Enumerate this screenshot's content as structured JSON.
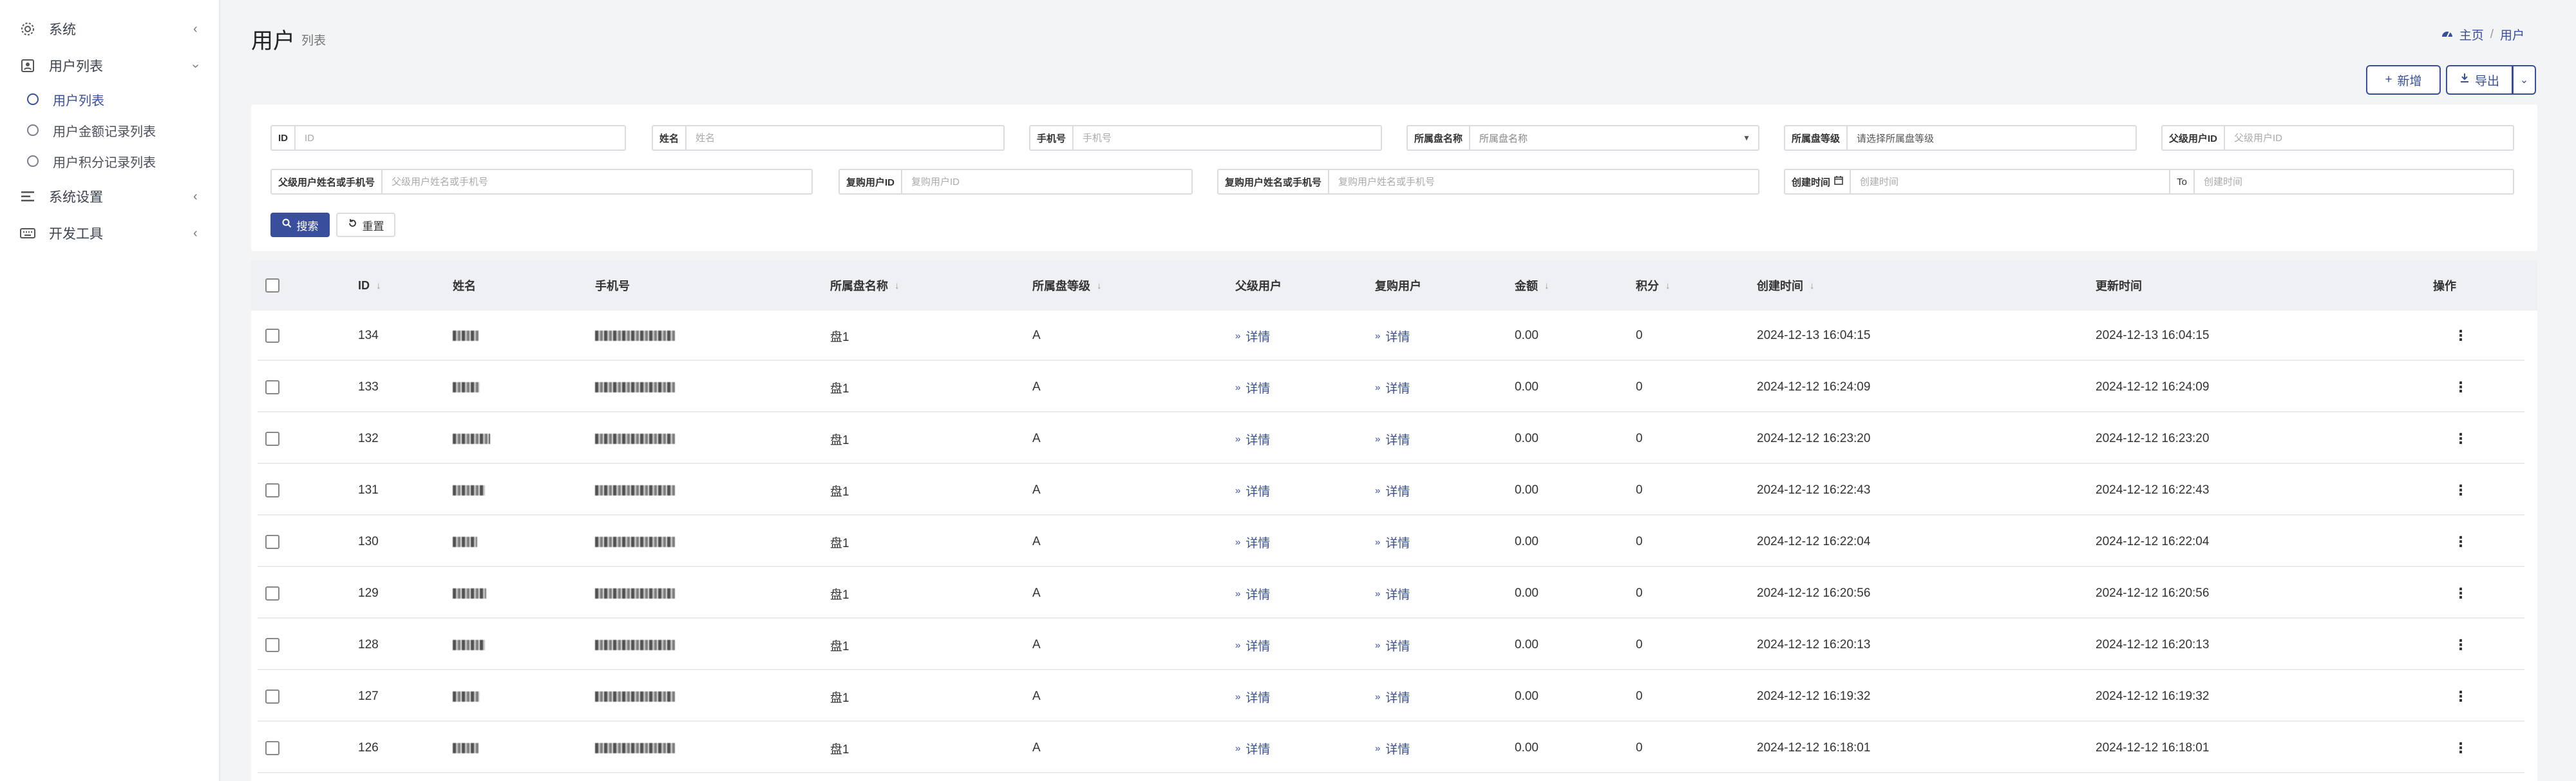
{
  "sidebar": {
    "items": [
      {
        "label": "系统",
        "icon": "gear-icon"
      },
      {
        "label": "用户列表",
        "icon": "user-box-icon"
      },
      {
        "label": "系统设置",
        "icon": "list-icon"
      },
      {
        "label": "开发工具",
        "icon": "keyboard-icon"
      }
    ],
    "sub_items": [
      {
        "label": "用户列表",
        "active": true
      },
      {
        "label": "用户金额记录列表",
        "active": false
      },
      {
        "label": "用户积分记录列表",
        "active": false
      }
    ]
  },
  "header": {
    "title": "用户",
    "subtitle": "列表",
    "breadcrumb": [
      "主页",
      "用户"
    ]
  },
  "toolbar": {
    "add_label": "新增",
    "export_label": "导出"
  },
  "filters": {
    "id": {
      "label": "ID",
      "placeholder": "ID"
    },
    "name": {
      "label": "姓名",
      "placeholder": "姓名"
    },
    "phone": {
      "label": "手机号",
      "placeholder": "手机号"
    },
    "disk_name": {
      "label": "所属盘名称",
      "placeholder": "所属盘名称"
    },
    "disk_level": {
      "label": "所属盘等级",
      "placeholder": "请选择所属盘等级"
    },
    "parent_id": {
      "label": "父级用户ID",
      "placeholder": "父级用户ID"
    },
    "parent_name": {
      "label": "父级用户姓名或手机号",
      "placeholder": "父级用户姓名或手机号"
    },
    "repurchase_id": {
      "label": "复购用户ID",
      "placeholder": "复购用户ID"
    },
    "repurchase_name": {
      "label": "复购用户姓名或手机号",
      "placeholder": "复购用户姓名或手机号"
    },
    "created": {
      "label": "创建时间",
      "placeholder_start": "创建时间",
      "to": "To",
      "placeholder_end": "创建时间"
    },
    "search_label": "搜索",
    "reset_label": "重置"
  },
  "table": {
    "columns": [
      "ID",
      "姓名",
      "手机号",
      "所属盘名称",
      "所属盘等级",
      "父级用户",
      "复购用户",
      "金额",
      "积分",
      "创建时间",
      "更新时间",
      "操作"
    ],
    "detail_label": "详情",
    "rows": [
      {
        "id": "134",
        "disk": "盘1",
        "level": "A",
        "amount": "0.00",
        "points": "0",
        "created": "2024-12-13 16:04:15",
        "updated": "2024-12-13 16:04:15"
      },
      {
        "id": "133",
        "disk": "盘1",
        "level": "A",
        "amount": "0.00",
        "points": "0",
        "created": "2024-12-12 16:24:09",
        "updated": "2024-12-12 16:24:09"
      },
      {
        "id": "132",
        "disk": "盘1",
        "level": "A",
        "amount": "0.00",
        "points": "0",
        "created": "2024-12-12 16:23:20",
        "updated": "2024-12-12 16:23:20"
      },
      {
        "id": "131",
        "disk": "盘1",
        "level": "A",
        "amount": "0.00",
        "points": "0",
        "created": "2024-12-12 16:22:43",
        "updated": "2024-12-12 16:22:43"
      },
      {
        "id": "130",
        "disk": "盘1",
        "level": "A",
        "amount": "0.00",
        "points": "0",
        "created": "2024-12-12 16:22:04",
        "updated": "2024-12-12 16:22:04"
      },
      {
        "id": "129",
        "disk": "盘1",
        "level": "A",
        "amount": "0.00",
        "points": "0",
        "created": "2024-12-12 16:20:56",
        "updated": "2024-12-12 16:20:56"
      },
      {
        "id": "128",
        "disk": "盘1",
        "level": "A",
        "amount": "0.00",
        "points": "0",
        "created": "2024-12-12 16:20:13",
        "updated": "2024-12-12 16:20:13"
      },
      {
        "id": "127",
        "disk": "盘1",
        "level": "A",
        "amount": "0.00",
        "points": "0",
        "created": "2024-12-12 16:19:32",
        "updated": "2024-12-12 16:19:32"
      },
      {
        "id": "126",
        "disk": "盘1",
        "level": "A",
        "amount": "0.00",
        "points": "0",
        "created": "2024-12-12 16:18:01",
        "updated": "2024-12-12 16:18:01"
      }
    ]
  },
  "colors": {
    "accent": "#3a4f9c",
    "header_bg": "#eef0f3",
    "page_bg": "#f3f4f6"
  }
}
